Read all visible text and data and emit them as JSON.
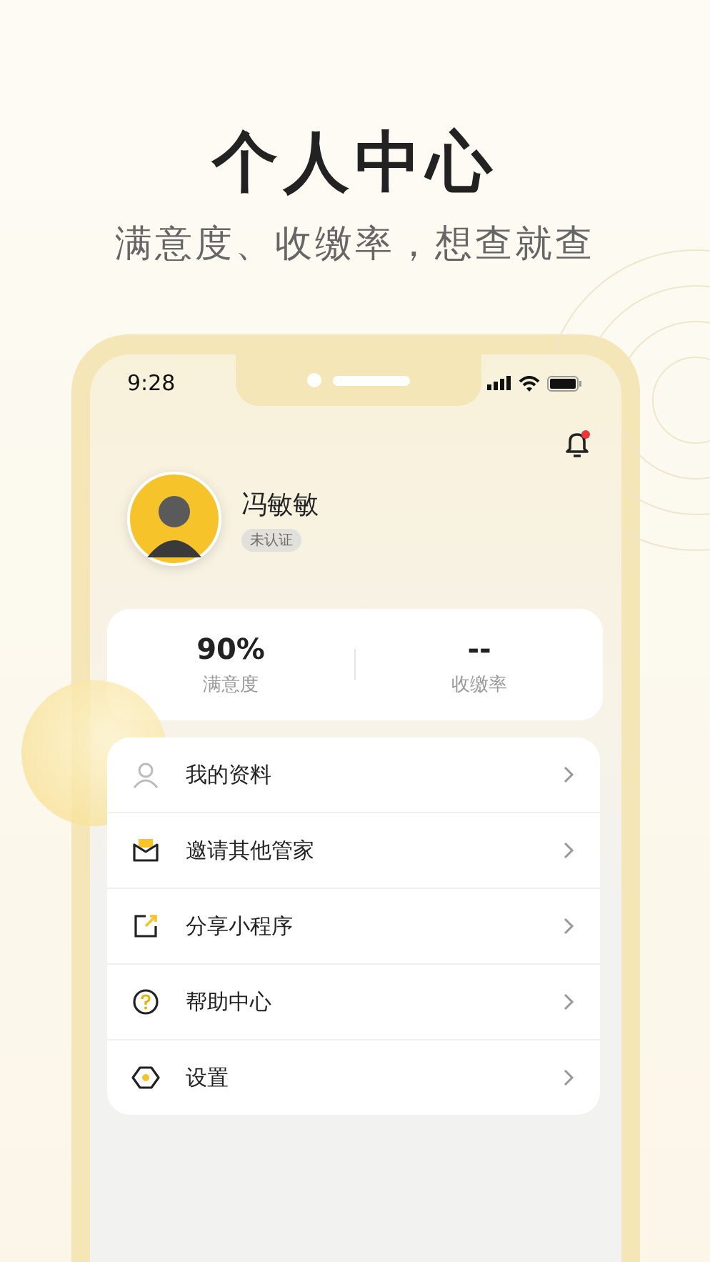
{
  "headline": {
    "title": "个人中心",
    "subtitle": "满意度、收缴率，想查就查"
  },
  "status_bar": {
    "time": "9:28"
  },
  "profile": {
    "name": "冯敏敏",
    "badge": "未认证"
  },
  "stats": [
    {
      "value": "90%",
      "label": "满意度"
    },
    {
      "value": "--",
      "label": "收缴率"
    }
  ],
  "menu": [
    {
      "kind": "person",
      "label": "我的资料"
    },
    {
      "kind": "mail",
      "label": "邀请其他管家"
    },
    {
      "kind": "share",
      "label": "分享小程序"
    },
    {
      "kind": "help",
      "label": "帮助中心"
    },
    {
      "kind": "settings",
      "label": "设置"
    }
  ]
}
